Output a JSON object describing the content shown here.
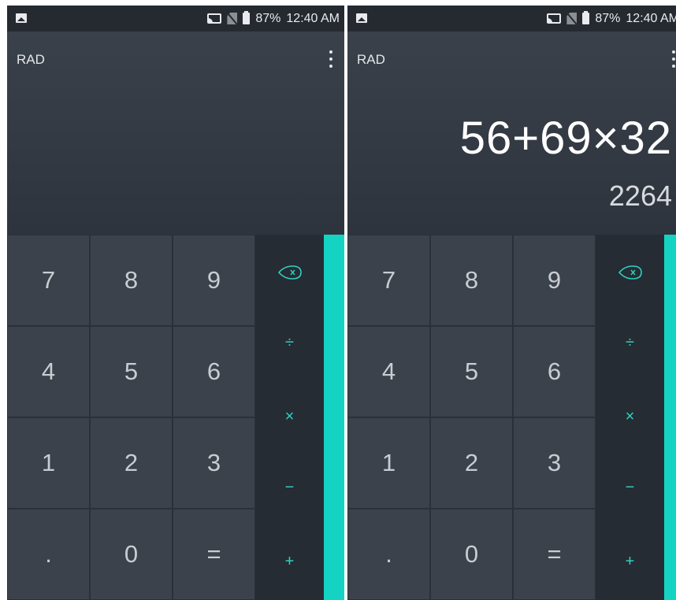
{
  "status": {
    "battery": "87%",
    "time": "12:40 AM",
    "icons": [
      "image-icon",
      "cast-icon",
      "no-sim-icon",
      "battery-icon"
    ]
  },
  "screens": [
    {
      "mode": "RAD",
      "formula": "",
      "result": "",
      "keys": [
        "7",
        "8",
        "9",
        "4",
        "5",
        "6",
        "1",
        "2",
        "3",
        ".",
        "0",
        "="
      ],
      "ops": [
        "÷",
        "×",
        "−",
        "+"
      ]
    },
    {
      "mode": "RAD",
      "formula": "56+69×32",
      "result": "2264",
      "keys": [
        "7",
        "8",
        "9",
        "4",
        "5",
        "6",
        "1",
        "2",
        "3",
        ".",
        "0",
        "="
      ],
      "ops": [
        "÷",
        "×",
        "−",
        "+"
      ]
    }
  ],
  "colors": {
    "accent": "#14d3c3",
    "operator_text": "#2fd1c1",
    "display_bg": "#3a414b",
    "key_bg": "#3b424c",
    "op_bg": "#262c33"
  }
}
